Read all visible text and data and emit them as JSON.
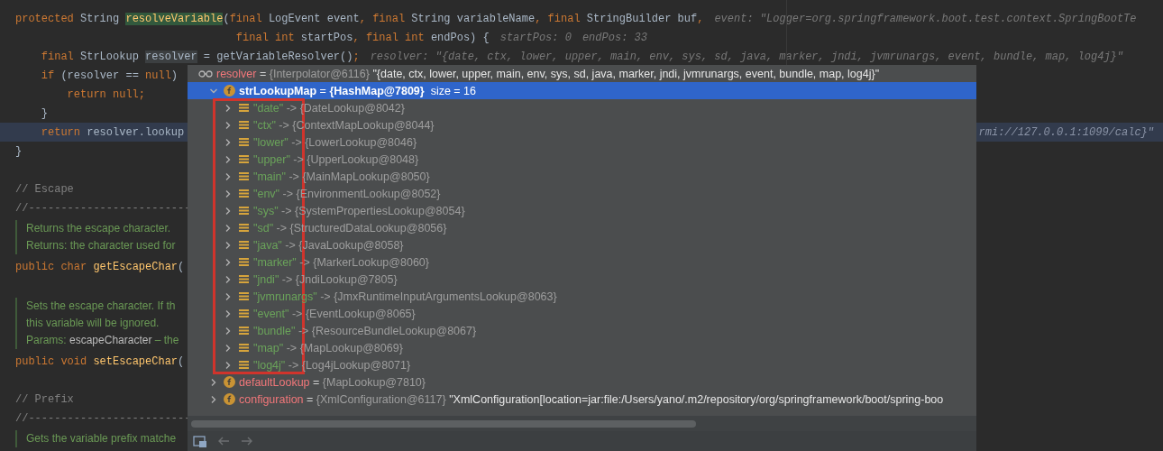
{
  "editor": {
    "blocks": [
      {
        "kind": "code",
        "highlighted": false,
        "segments": [
          {
            "text": "protected ",
            "kind": "keyword"
          },
          {
            "text": "String ",
            "kind": "plain"
          },
          {
            "text": "resolveVariable",
            "kind": "method-highlight"
          },
          {
            "text": "(",
            "kind": "plain"
          },
          {
            "text": "final ",
            "kind": "keyword"
          },
          {
            "text": "LogEvent event",
            "kind": "plain"
          },
          {
            "text": ", ",
            "kind": "keyword"
          },
          {
            "text": "final ",
            "kind": "keyword"
          },
          {
            "text": "String variableName",
            "kind": "plain"
          },
          {
            "text": ", ",
            "kind": "keyword"
          },
          {
            "text": "final ",
            "kind": "keyword"
          },
          {
            "text": "StringBuilder buf",
            "kind": "plain"
          },
          {
            "text": ",",
            "kind": "keyword"
          },
          {
            "text": "event: \"Logger=org.springframework.boot.test.context.SpringBootTe",
            "kind": "inlay"
          }
        ]
      },
      {
        "kind": "code",
        "highlighted": false,
        "segments": [
          {
            "text": "                                  final int ",
            "kind": "keyword"
          },
          {
            "text": "startPos",
            "kind": "plain"
          },
          {
            "text": ", ",
            "kind": "keyword"
          },
          {
            "text": "final int ",
            "kind": "keyword"
          },
          {
            "text": "endPos) {",
            "kind": "plain"
          },
          {
            "text": "startPos: 0",
            "kind": "inlay"
          },
          {
            "text": "endPos: 33",
            "kind": "inlay"
          }
        ]
      },
      {
        "kind": "code",
        "highlighted": false,
        "segments": [
          {
            "text": "    final ",
            "kind": "keyword"
          },
          {
            "text": "StrLookup ",
            "kind": "plain"
          },
          {
            "text": "resolver",
            "kind": "usage"
          },
          {
            "text": " = getVariableResolver()",
            "kind": "plain"
          },
          {
            "text": ";",
            "kind": "keyword"
          },
          {
            "text": "resolver: \"{date, ctx, lower, upper, main, env, sys, sd, java, marker, jndi, jvmrunargs, event, bundle, map, log4j}\"",
            "kind": "inlay"
          }
        ]
      },
      {
        "kind": "code",
        "highlighted": false,
        "segments": [
          {
            "text": "    if ",
            "kind": "keyword"
          },
          {
            "text": "(resolver == ",
            "kind": "plain"
          },
          {
            "text": "null",
            "kind": "keyword"
          },
          {
            "text": ")",
            "kind": "plain"
          }
        ]
      },
      {
        "kind": "code",
        "highlighted": false,
        "segments": [
          {
            "text": "        return null",
            "kind": "keyword"
          },
          {
            "text": ";",
            "kind": "keyword"
          }
        ]
      },
      {
        "kind": "code",
        "highlighted": false,
        "segments": [
          {
            "text": "    }",
            "kind": "plain"
          }
        ]
      },
      {
        "kind": "code",
        "highlighted": true,
        "segments": [
          {
            "text": "    return ",
            "kind": "keyword"
          },
          {
            "text": "resolver.lookup",
            "kind": "plain"
          },
          {
            "text": "rmi://127.0.0.1:1099/calc}\"",
            "kind": "inlay-right"
          }
        ]
      },
      {
        "kind": "code",
        "highlighted": false,
        "segments": [
          {
            "text": "}",
            "kind": "plain"
          }
        ]
      },
      {
        "kind": "blank"
      },
      {
        "kind": "code",
        "highlighted": false,
        "segments": [
          {
            "text": "// Escape",
            "kind": "comment"
          }
        ]
      },
      {
        "kind": "code",
        "highlighted": false,
        "segments": [
          {
            "text": "//-------------------------",
            "kind": "comment"
          }
        ]
      },
      {
        "kind": "doc",
        "paragraphs": [
          [
            {
              "text": "Returns the escape character.",
              "kind": "doc"
            }
          ],
          [
            {
              "text": "Returns: ",
              "kind": "doc"
            },
            {
              "text": "the character used for",
              "kind": "doc"
            }
          ]
        ]
      },
      {
        "kind": "code",
        "highlighted": false,
        "segments": [
          {
            "text": "public char ",
            "kind": "keyword"
          },
          {
            "text": "getEscapeChar",
            "kind": "method"
          },
          {
            "text": "(",
            "kind": "plain"
          }
        ]
      },
      {
        "kind": "blank"
      },
      {
        "kind": "doc",
        "paragraphs": [
          [
            {
              "text": "Sets the escape character. If th",
              "kind": "doc"
            }
          ],
          [
            {
              "text": "this variable will be ignored.",
              "kind": "doc"
            }
          ],
          [
            {
              "text": "Params: ",
              "kind": "doc"
            },
            {
              "text": "escapeCharacter",
              "kind": "doc-code"
            },
            {
              "text": " – the",
              "kind": "doc"
            }
          ]
        ]
      },
      {
        "kind": "code",
        "highlighted": false,
        "segments": [
          {
            "text": "public void ",
            "kind": "keyword"
          },
          {
            "text": "setEscapeChar",
            "kind": "method"
          },
          {
            "text": "(",
            "kind": "plain"
          }
        ]
      },
      {
        "kind": "blank"
      },
      {
        "kind": "code",
        "highlighted": false,
        "segments": [
          {
            "text": "// Prefix",
            "kind": "comment"
          }
        ]
      },
      {
        "kind": "code",
        "highlighted": false,
        "segments": [
          {
            "text": "//-------------------------",
            "kind": "comment"
          }
        ]
      },
      {
        "kind": "doc",
        "paragraphs": [
          [
            {
              "text": "Gets the variable prefix matche",
              "kind": "doc"
            }
          ]
        ]
      }
    ]
  },
  "debugger_popup": {
    "header": {
      "name": "resolver",
      "sign": "=",
      "type": "{Interpolator@6116}",
      "value": "\"{date, ctx, lower, upper, main, env, sys, sd, java, marker, jndi, jvmrunargs, event, bundle, map, log4j}\""
    },
    "nodes": [
      {
        "name": "strLookupMap",
        "sign": "=",
        "type": "{HashMap@7809}",
        "extra": "size = 16",
        "selected": true,
        "expanded": true,
        "children": [
          {
            "key": "\"date\"",
            "sign": "->",
            "type": "{DateLookup@8042}",
            "expanded": false
          },
          {
            "key": "\"ctx\"",
            "sign": "->",
            "type": "{ContextMapLookup@8044}",
            "expanded": false
          },
          {
            "key": "\"lower\"",
            "sign": "->",
            "type": "{LowerLookup@8046}",
            "expanded": false
          },
          {
            "key": "\"upper\"",
            "sign": "->",
            "type": "{UpperLookup@8048}",
            "expanded": false
          },
          {
            "key": "\"main\"",
            "sign": "->",
            "type": "{MainMapLookup@8050}",
            "expanded": false
          },
          {
            "key": "\"env\"",
            "sign": "->",
            "type": "{EnvironmentLookup@8052}",
            "expanded": false
          },
          {
            "key": "\"sys\"",
            "sign": "->",
            "type": "{SystemPropertiesLookup@8054}",
            "expanded": false
          },
          {
            "key": "\"sd\"",
            "sign": "->",
            "type": "{StructuredDataLookup@8056}",
            "expanded": false
          },
          {
            "key": "\"java\"",
            "sign": "->",
            "type": "{JavaLookup@8058}",
            "expanded": false
          },
          {
            "key": "\"marker\"",
            "sign": "->",
            "type": "{MarkerLookup@8060}",
            "expanded": false
          },
          {
            "key": "\"jndi\"",
            "sign": "->",
            "type": "{JndiLookup@7805}",
            "expanded": false
          },
          {
            "key": "\"jvmrunargs\"",
            "sign": "->",
            "type": "{JmxRuntimeInputArgumentsLookup@8063}",
            "expanded": false
          },
          {
            "key": "\"event\"",
            "sign": "->",
            "type": "{EventLookup@8065}",
            "expanded": false
          },
          {
            "key": "\"bundle\"",
            "sign": "->",
            "type": "{ResourceBundleLookup@8067}",
            "expanded": false
          },
          {
            "key": "\"map\"",
            "sign": "->",
            "type": "{MapLookup@8069}",
            "expanded": false
          },
          {
            "key": "\"log4j\"",
            "sign": "->",
            "type": "{Log4jLookup@8071}",
            "expanded": false
          }
        ]
      },
      {
        "name": "defaultLookup",
        "sign": "=",
        "type": "{MapLookup@7810}",
        "selected": false,
        "expanded": false
      },
      {
        "name": "configuration",
        "sign": "=",
        "type": "{XmlConfiguration@6117}",
        "value": "\"XmlConfiguration[location=jar:file:/Users/yano/.m2/repository/org/springframework/boot/spring-boo",
        "selected": false,
        "expanded": false
      }
    ]
  }
}
